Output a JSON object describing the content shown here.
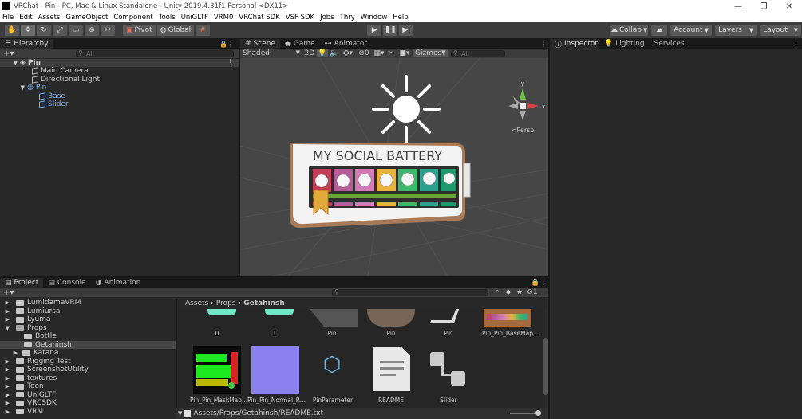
{
  "window": {
    "title": "VRChat - Pin - PC, Mac & Linux Standalone - Unity 2019.4.31f1 Personal <DX11>"
  },
  "menu": [
    "File",
    "Edit",
    "Assets",
    "GameObject",
    "Component",
    "Tools",
    "UniGLTF",
    "VRM0",
    "VRChat SDK",
    "VSF SDK",
    "Jobs",
    "Thry",
    "Window",
    "Help"
  ],
  "toolbar": {
    "pivot": "Pivot",
    "global": "Global",
    "collab": "Collab",
    "account": "Account",
    "layers": "Layers",
    "layout": "Layout"
  },
  "hierarchy": {
    "tab": "Hierarchy",
    "search": "All",
    "scene": "Pin",
    "items": [
      "Main Camera",
      "Directional Light",
      "Pin",
      "Base",
      "Slider"
    ]
  },
  "scene": {
    "tabs": [
      "Scene",
      "Game",
      "Animator"
    ],
    "shading": "Shaded",
    "mode2d": "2D",
    "hidden": "0",
    "gizmos": "Gizmos",
    "search": "All",
    "persp": "<Persp",
    "axis_x": "x",
    "axis_y": "y",
    "pin_title": "MY SOCIAL BATTERY"
  },
  "inspector": {
    "tabs": [
      "Inspector",
      "Lighting",
      "Services"
    ]
  },
  "project": {
    "tabs": [
      "Project",
      "Console",
      "Animation"
    ],
    "count": "1",
    "breadcrumb": [
      "Assets",
      "Props",
      "Getahinsh"
    ],
    "folders": [
      "LumidamaVRM",
      "Lumiursa",
      "Lyuma",
      "Props",
      "Bottle",
      "Getahinsh",
      "Katana",
      "Rigging Test",
      "ScreenshotUtility",
      "textures",
      "Toon",
      "UniGLTF",
      "VRCSDK",
      "VRM"
    ],
    "assets_row1": [
      "0",
      "1",
      "Pin",
      "Pin",
      "Pin",
      "Pin_Pin_BaseMap..."
    ],
    "assets_row2": [
      "Pin_Pin_MaskMap...",
      "Pin_Pin_Normal_R...",
      "PinParameter",
      "README",
      "Slider"
    ],
    "status_path": "Assets/Props/Getahinsh/README.txt"
  },
  "colors": {
    "accent": "#2c5d87",
    "selected_text": "#7cb0f5",
    "battery": [
      "#c23e57",
      "#b55d99",
      "#d27bb7",
      "#e8b33a",
      "#3eb86a",
      "#2aa08d",
      "#1f9a6e"
    ]
  }
}
